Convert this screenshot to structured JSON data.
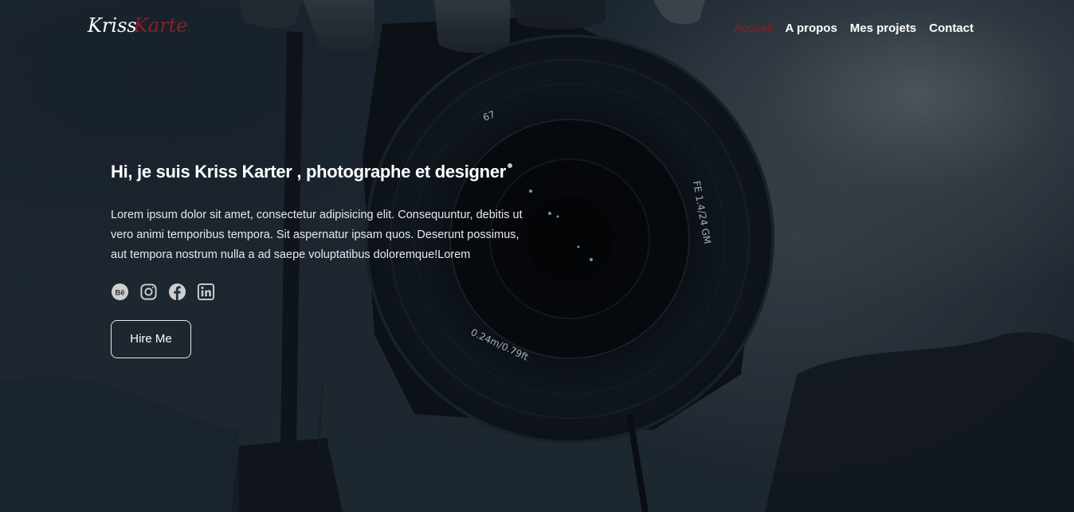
{
  "logo": {
    "first": "Kriss",
    "second": "Karter",
    "accent_color": "#8b1f23"
  },
  "nav": {
    "items": [
      {
        "label": "Accueil",
        "active": true
      },
      {
        "label": "A propos",
        "active": false
      },
      {
        "label": "Mes projets",
        "active": false
      },
      {
        "label": "Contact",
        "active": false
      }
    ]
  },
  "hero": {
    "headline": "Hi, je suis Kriss Karter , photographe et designer",
    "intro": "Lorem ipsum dolor sit amet, consectetur adipisicing elit. Consequuntur, debitis ut vero animi temporibus tempora. Sit aspernatur ipsam quos. Deserunt possimus, aut tempora nostrum nulla a ad saepe voluptatibus doloremque!Lorem",
    "lens_text_1": "67",
    "lens_text_2": "FE 1.4/24 GM",
    "lens_text_3": "0.24m/0.79ft",
    "cta_label": "Hire Me"
  },
  "socials": [
    {
      "icon": "behance-icon",
      "glyph": "Bē"
    },
    {
      "icon": "instagram-icon"
    },
    {
      "icon": "facebook-icon"
    },
    {
      "icon": "linkedin-icon"
    }
  ]
}
